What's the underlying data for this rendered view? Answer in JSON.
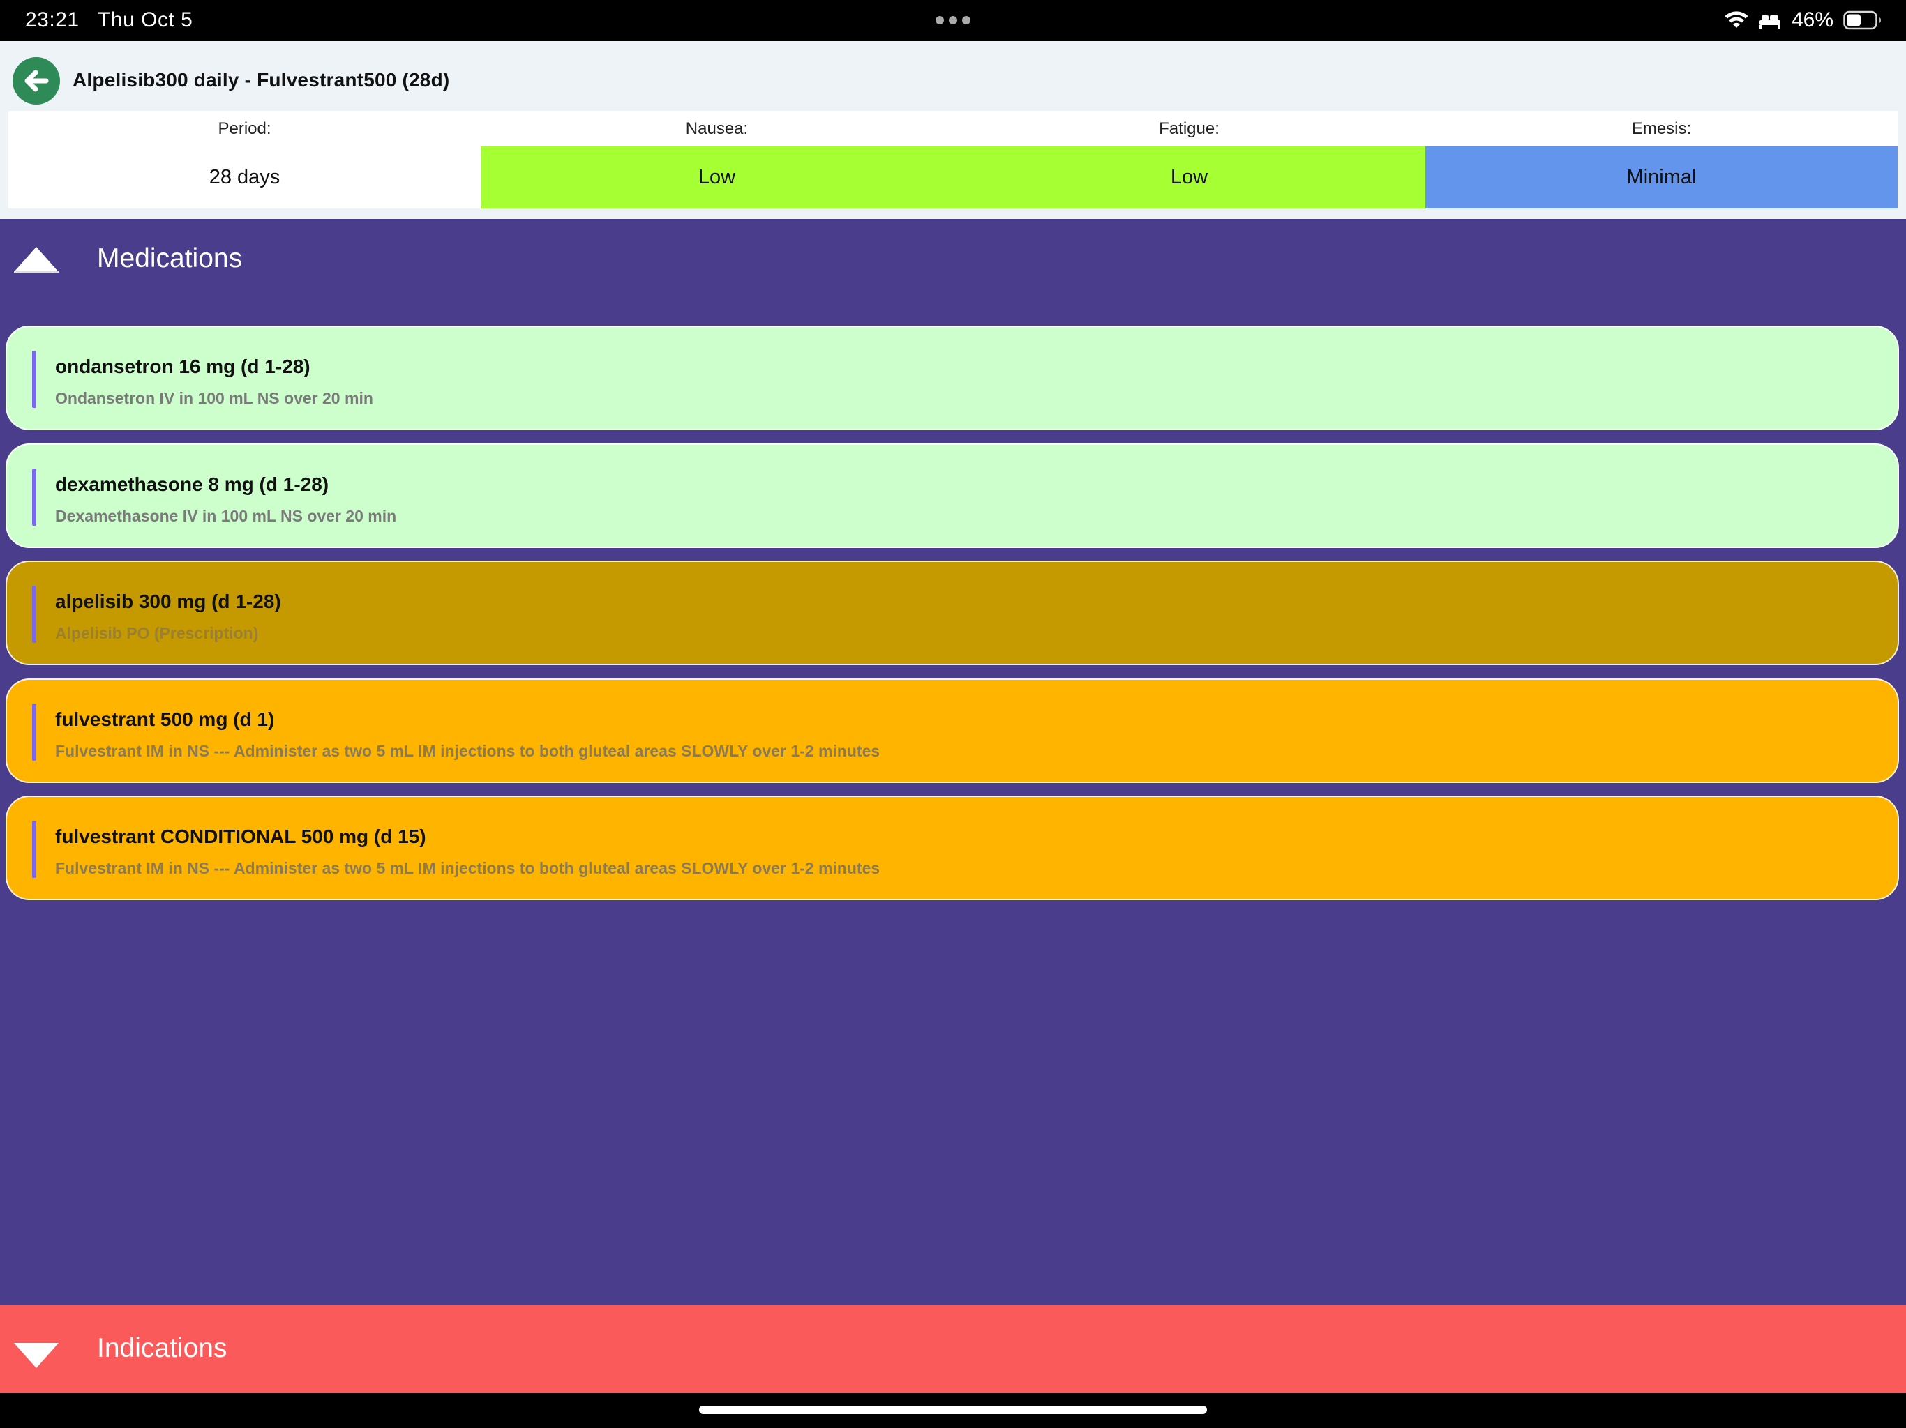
{
  "status_bar": {
    "time": "23:21",
    "date": "Thu Oct 5",
    "battery": "46%",
    "icons": [
      "multitasking-dots-icon",
      "wifi-icon",
      "bed-icon",
      "battery-icon"
    ]
  },
  "header": {
    "title": "Alpelisib300 daily - Fulvestrant500 (28d)",
    "back_icon": "back-arrow-icon"
  },
  "stats": [
    {
      "label": "Period:",
      "value": "28 days",
      "color": "#ffffff"
    },
    {
      "label": "Nausea:",
      "value": "Low",
      "color": "#a6ff33"
    },
    {
      "label": "Fatigue:",
      "value": "Low",
      "color": "#a6ff33"
    },
    {
      "label": "Emesis:",
      "value": "Minimal",
      "color": "#6495ed"
    }
  ],
  "medications": {
    "title": "Medications",
    "toggle_icon": "collapse-triangle-up-icon",
    "background": "#4a3e8c",
    "items": [
      {
        "name": "ondansetron 16 mg (d 1-28)",
        "description": "Ondansetron IV in 100 mL NS over 20 min",
        "color": "#ccffcc"
      },
      {
        "name": "dexamethasone 8 mg (d 1-28)",
        "description": "Dexamethasone IV in 100 mL NS over 20 min",
        "color": "#ccffcc"
      },
      {
        "name": "alpelisib 300 mg (d 1-28)",
        "description": "Alpelisib PO (Prescription)",
        "color": "#c49a00"
      },
      {
        "name": "fulvestrant 500 mg (d 1)",
        "description": "Fulvestrant IM in NS --- Administer as two 5 mL IM injections to both gluteal areas SLOWLY over 1-2 minutes",
        "color": "#ffb400"
      },
      {
        "name": "fulvestrant CONDITIONAL 500 mg (d 15)",
        "description": "Fulvestrant IM in NS --- Administer as two 5 mL IM injections to both gluteal areas SLOWLY over 1-2 minutes",
        "color": "#ffb400"
      }
    ]
  },
  "indications": {
    "title": "Indications",
    "toggle_icon": "expand-triangle-down-icon",
    "background": "#fa5a5a"
  }
}
